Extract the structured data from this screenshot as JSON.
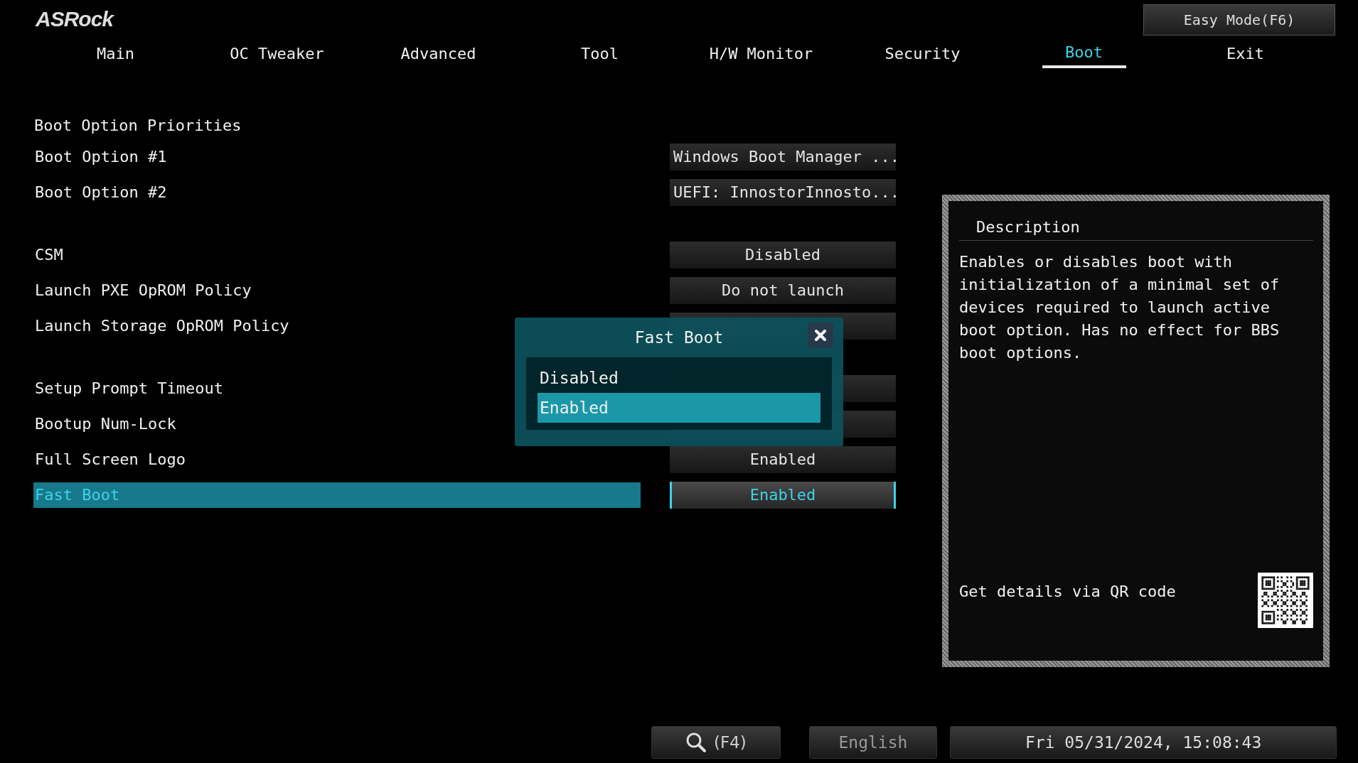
{
  "logo": "ASRock",
  "easy_mode_button": "Easy Mode(F6)",
  "tabs": [
    {
      "label": "Main",
      "selected": false
    },
    {
      "label": "OC Tweaker",
      "selected": false
    },
    {
      "label": "Advanced",
      "selected": false
    },
    {
      "label": "Tool",
      "selected": false
    },
    {
      "label": "H/W Monitor",
      "selected": false
    },
    {
      "label": "Security",
      "selected": false
    },
    {
      "label": "Boot",
      "selected": true
    },
    {
      "label": "Exit",
      "selected": false
    }
  ],
  "settings": [
    {
      "kind": "heading",
      "label": "Boot Option Priorities"
    },
    {
      "kind": "device",
      "label": "Boot Option #1",
      "value": "Windows Boot Manager ...",
      "selected": false
    },
    {
      "kind": "device",
      "label": "Boot Option #2",
      "value": "UEFI: InnostorInnosto...",
      "selected": false
    },
    {
      "kind": "spacer"
    },
    {
      "kind": "option",
      "label": "CSM",
      "value": "Disabled",
      "selected": false
    },
    {
      "kind": "option",
      "label": "Launch PXE OpROM Policy",
      "value": "Do not launch",
      "selected": false
    },
    {
      "kind": "option",
      "label": "Launch Storage OpROM Policy",
      "selected": false
    },
    {
      "kind": "spacer"
    },
    {
      "kind": "option",
      "label": "Setup Prompt Timeout",
      "selected": false
    },
    {
      "kind": "option",
      "label": "Bootup Num-Lock",
      "selected": false
    },
    {
      "kind": "option",
      "label": "Full Screen Logo",
      "value": "Enabled",
      "selected": false
    },
    {
      "kind": "option",
      "label": "Fast Boot",
      "value": "Enabled",
      "selected": true
    }
  ],
  "popup": {
    "title": "Fast Boot",
    "options": [
      {
        "label": "Disabled",
        "selected": false
      },
      {
        "label": "Enabled",
        "selected": true
      }
    ]
  },
  "description": {
    "title": "Description",
    "text": "Enables or disables boot with initialization of a minimal set of devices required to launch active boot option. Has no effect for BBS boot options.",
    "qr_caption": "Get details via QR code"
  },
  "footer": {
    "search_key": "(F4)",
    "language": "English",
    "datetime": "Fri 05/31/2024, 15:08:43"
  }
}
